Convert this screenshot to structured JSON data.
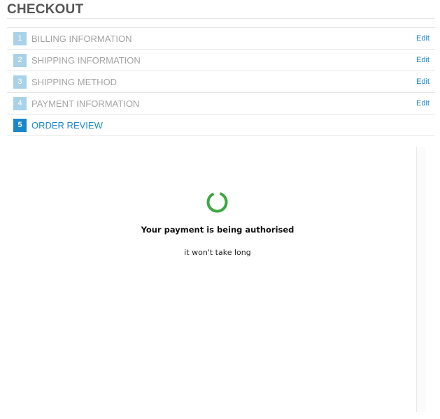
{
  "header": {
    "title": "CHECKOUT"
  },
  "steps": [
    {
      "number": "1",
      "label": "BILLING INFORMATION",
      "edit": "Edit"
    },
    {
      "number": "2",
      "label": "SHIPPING INFORMATION",
      "edit": "Edit"
    },
    {
      "number": "3",
      "label": "SHIPPING METHOD",
      "edit": "Edit"
    },
    {
      "number": "4",
      "label": "PAYMENT INFORMATION",
      "edit": "Edit"
    },
    {
      "number": "5",
      "label": "ORDER REVIEW",
      "active": true
    }
  ],
  "status": {
    "title": "Your payment is being authorised",
    "subtitle": "it won't take long",
    "spinner_icon": "loading-spinner-icon"
  },
  "colors": {
    "accent": "#1a86c8",
    "step_badge_inactive": "#a9d2e8",
    "spinner": "#3aa840",
    "muted_text": "#a3a3a3"
  }
}
